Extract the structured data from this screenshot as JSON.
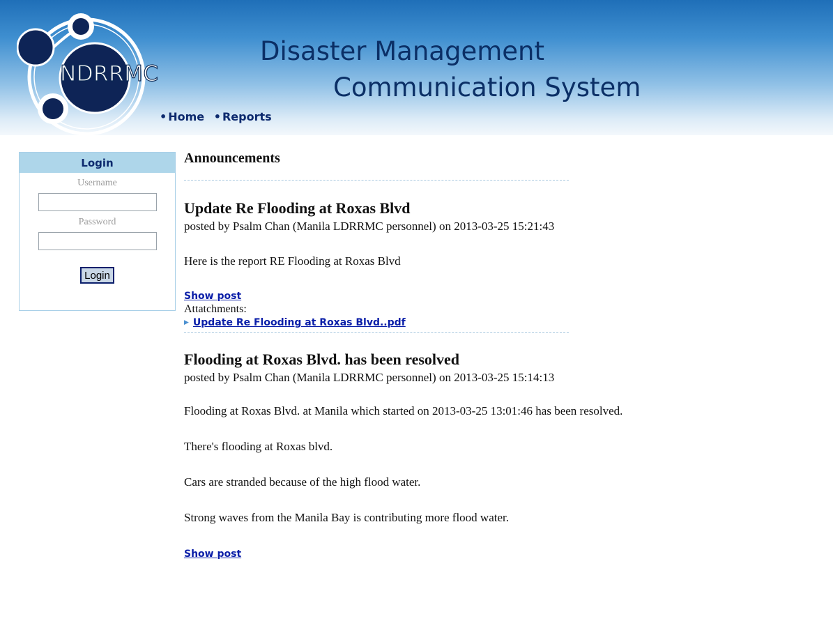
{
  "header": {
    "logo_text": "NDRRMC",
    "title_line1": "Disaster Management",
    "title_line2": "Communication System",
    "nav": [
      {
        "label": "Home"
      },
      {
        "label": "Reports"
      }
    ],
    "bullet": "•"
  },
  "login": {
    "heading": "Login",
    "username_label": "Username",
    "username_value": "",
    "password_label": "Password",
    "password_value": "",
    "button_label": "Login"
  },
  "announcements": {
    "heading": "Announcements",
    "show_post_label": "Show post",
    "posts": [
      {
        "title": "Update Re Flooding at Roxas Blvd",
        "byline": "posted by Psalm Chan (Manila LDRRMC personnel) on 2013-03-25 15:21:43",
        "paragraphs": [
          "Here is the report RE Flooding at Roxas Blvd"
        ],
        "attachments_label": "Attatchments:",
        "attachments": [
          "Update Re Flooding at Roxas Blvd..pdf"
        ]
      },
      {
        "title": "Flooding at Roxas Blvd. has been resolved",
        "byline": "posted by Psalm Chan (Manila LDRRMC personnel) on 2013-03-25 15:14:13",
        "paragraphs": [
          "Flooding at Roxas Blvd. at Manila which started on 2013-03-25 13:01:46 has been resolved.",
          "There's flooding at Roxas blvd.",
          "Cars are stranded because of the high flood water.",
          "Strong waves from the Manila Bay is contributing more flood water."
        ]
      }
    ]
  }
}
